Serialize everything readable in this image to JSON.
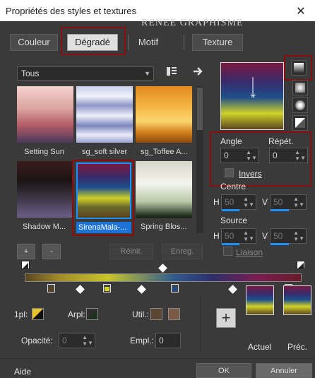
{
  "window": {
    "title": "Propriétés des styles et textures",
    "watermark": "RENEE GRAPHISME",
    "close_glyph": "✕"
  },
  "tabs": [
    {
      "label": "Couleur"
    },
    {
      "label": "Dégradé",
      "active": true
    },
    {
      "label": "Motif"
    },
    {
      "label": "Texture"
    }
  ],
  "filter": {
    "value": "Tous"
  },
  "gradients": [
    {
      "label": "Setting Sun"
    },
    {
      "label": "sg_soft silver"
    },
    {
      "label": "sg_Toffee A..."
    },
    {
      "label": "Shadow M..."
    },
    {
      "label": "SirenaMala-...",
      "selected": true
    },
    {
      "label": "Spring Blos..."
    }
  ],
  "buttons": {
    "add": "+",
    "remove": "-",
    "reset": "Réinit.",
    "save": "Enreg."
  },
  "angle": {
    "label": "Angle",
    "value": "0"
  },
  "repeat": {
    "label": "Répét.",
    "value": "0"
  },
  "invert": {
    "label": "Invers",
    "checked": false
  },
  "center": {
    "label": "Centre",
    "h_label": "H",
    "h": "50",
    "v_label": "V",
    "v": "50"
  },
  "source": {
    "label": "Source",
    "h_label": "H",
    "h": "50",
    "v_label": "V",
    "v": "50"
  },
  "link": {
    "label": "Liaison"
  },
  "stops": {
    "pl_label": "1pl:",
    "arpl_label": "Arpl:",
    "util_label": "Util.:",
    "opacity_label": "Opacité:",
    "opacity_value": "0",
    "empl_label": "Empl.:",
    "empl_value": "0"
  },
  "previews": {
    "current": "Actuel",
    "previous": "Préc."
  },
  "footer": {
    "help": "Aide",
    "ok": "OK",
    "cancel": "Annuler"
  },
  "colors": {
    "accent_red": "#8b0d0d",
    "util_swatch1": "#5a4632",
    "util_swatch2": "#7a5a44",
    "pl_swatch": "#e8c22a"
  }
}
